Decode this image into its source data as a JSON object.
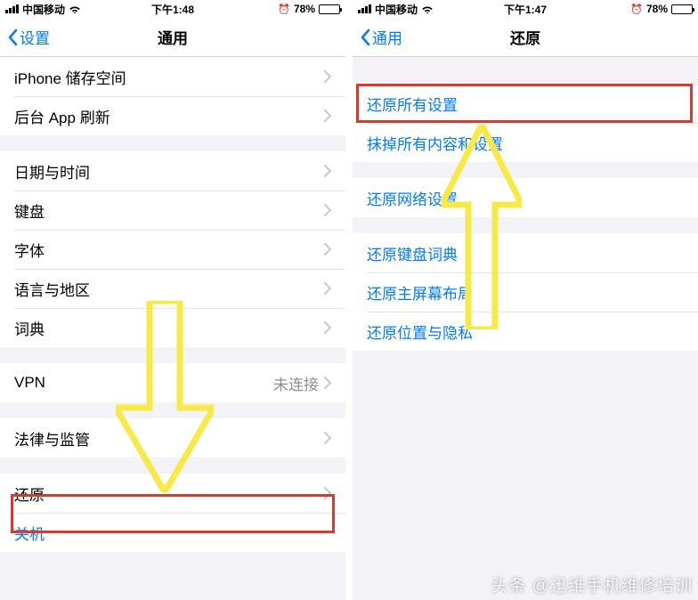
{
  "left": {
    "status": {
      "carrier": "中国移动",
      "time": "下午1:48",
      "battery_pct": "78%"
    },
    "nav": {
      "back": "设置",
      "title": "通用"
    },
    "rows": {
      "storage": "iPhone 储存空间",
      "bg_refresh": "后台 App 刷新",
      "datetime": "日期与时间",
      "keyboard": "键盘",
      "fonts": "字体",
      "lang_region": "语言与地区",
      "dictionary": "词典",
      "vpn": "VPN",
      "vpn_status": "未连接",
      "legal": "法律与监管",
      "reset": "还原",
      "shutdown": "关机"
    }
  },
  "right": {
    "status": {
      "carrier": "中国移动",
      "time": "下午1:47",
      "battery_pct": "78%"
    },
    "nav": {
      "back": "通用",
      "title": "还原"
    },
    "rows": {
      "reset_all": "还原所有设置",
      "erase_all": "抹掉所有内容和设置",
      "reset_network": "还原网络设置",
      "reset_keyboard": "还原键盘词典",
      "reset_home": "还原主屏幕布局",
      "reset_location": "还原位置与隐私"
    }
  },
  "watermark": "头条 @迅维手机维修培训"
}
